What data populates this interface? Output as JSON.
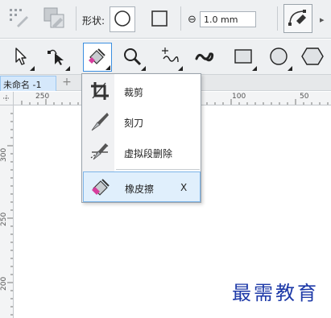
{
  "property_bar": {
    "shape_label": "形状:",
    "width_value": "1.0 mm"
  },
  "document": {
    "tab_name": "未命名 -1",
    "add_tab": "+"
  },
  "rulers": {
    "horizontal_ticks": [
      "250",
      "100",
      "50"
    ],
    "vertical_ticks": [
      "300",
      "250",
      "200"
    ]
  },
  "flyout": {
    "items": [
      {
        "label": "裁剪",
        "icon": "crop-icon"
      },
      {
        "label": "刻刀",
        "icon": "knife-icon"
      },
      {
        "label": "虚拟段删除",
        "icon": "virtual-segment-delete-icon"
      },
      {
        "label": "橡皮擦",
        "icon": "eraser-icon",
        "shortcut": "X",
        "selected": true
      }
    ]
  },
  "watermark": "最需教育",
  "colors": {
    "accent": "#3b8ee0",
    "eraser_pink": "#d63d9c",
    "watermark": "#1e3aa8"
  }
}
